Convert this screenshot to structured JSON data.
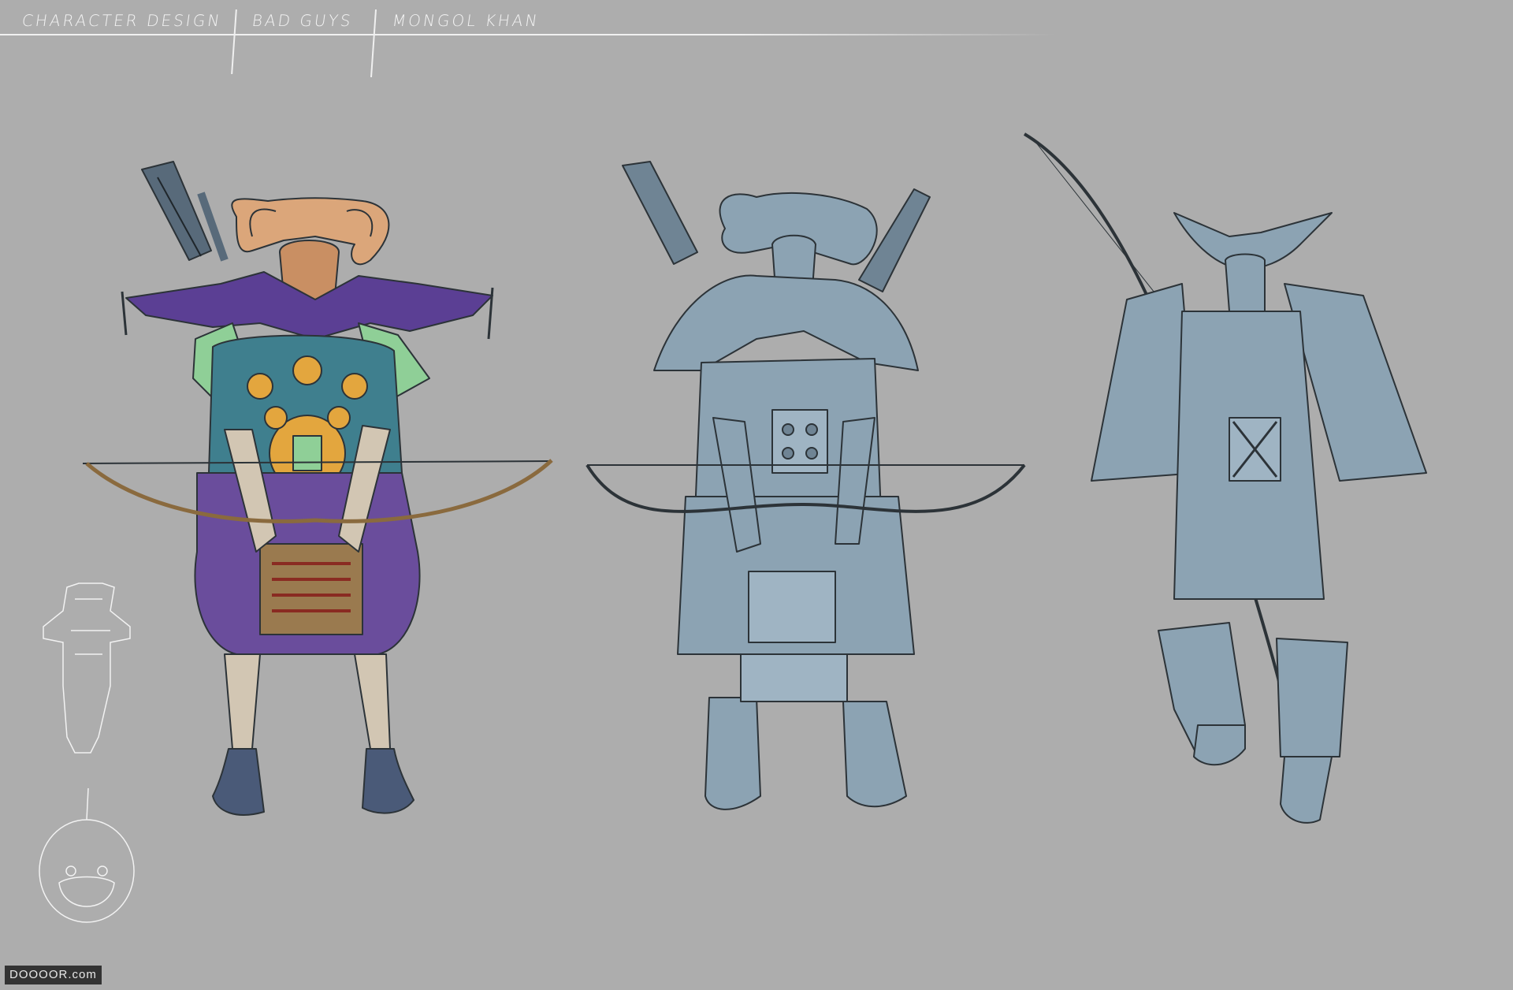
{
  "header": {
    "segment_1": "CHARACTER DESIGN",
    "segment_2": "BAD GUYS",
    "segment_3": "MONGOL KHAN"
  },
  "watermark": "DOOOOR.com",
  "colors": {
    "background": "#adadad",
    "sketch_line": "#2c3338",
    "blue_gray_fill": "#8ca3b3",
    "skin": "#d9a070",
    "robe_purple": "#6a4d9c",
    "teal_sleeves": "#3f7f8e",
    "gold": "#e3a63e",
    "jade_green": "#8fcf97",
    "leather_brown": "#9a7a4f"
  },
  "figures": [
    {
      "name": "colored-warrior",
      "icon": "mongol-warrior-colored"
    },
    {
      "name": "blue-warrior-front",
      "icon": "mongol-warrior-blue-front"
    },
    {
      "name": "blue-warrior-walking",
      "icon": "mongol-warrior-blue-walking"
    },
    {
      "name": "thumbnail-figure",
      "icon": "warrior-thumbnail-white"
    },
    {
      "name": "thumbnail-head",
      "icon": "warrior-head-sketch-white"
    }
  ]
}
